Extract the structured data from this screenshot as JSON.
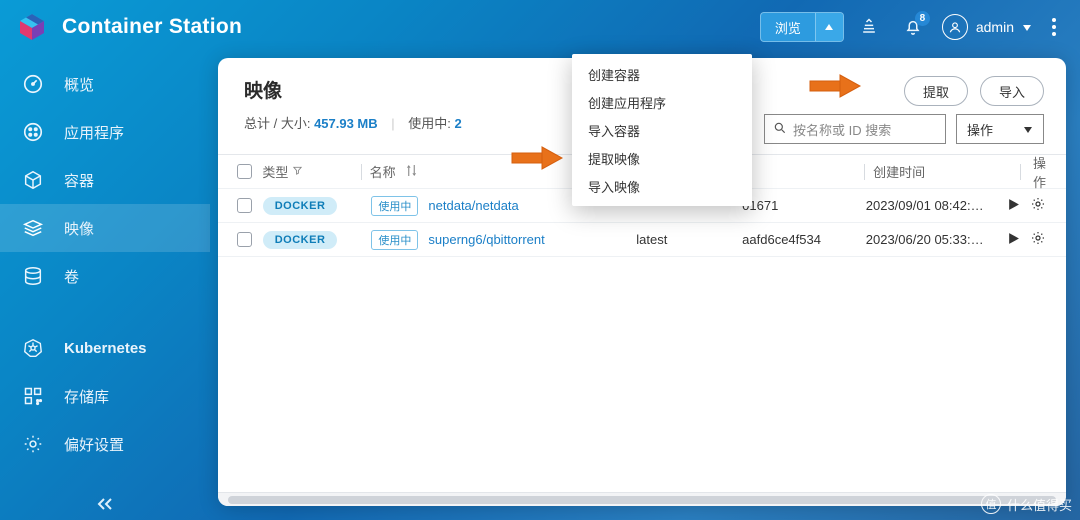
{
  "appTitle": "Container Station",
  "topbar": {
    "browseLabel": "浏览",
    "notifCount": "8",
    "userName": "admin"
  },
  "sidebar": {
    "items": [
      {
        "label": "概览"
      },
      {
        "label": "应用程序"
      },
      {
        "label": "容器"
      },
      {
        "label": "映像"
      },
      {
        "label": "卷"
      }
    ],
    "items2": [
      {
        "label": "Kubernetes"
      },
      {
        "label": "存储库"
      },
      {
        "label": "偏好设置"
      }
    ]
  },
  "panel": {
    "title": "映像",
    "totalsPrefix": "总计 / 大小: ",
    "totalsSize": "457.93 MB",
    "inusePrefix": "使用中: ",
    "inuseCount": "2",
    "pullBtn": "提取",
    "importBtn": "导入",
    "searchPlaceholder": "按名称或 ID 搜索",
    "opsLabel": "操作"
  },
  "dropdown": {
    "items": [
      "创建容器",
      "创建应用程序",
      "导入容器",
      "提取映像",
      "导入映像"
    ]
  },
  "table": {
    "headers": {
      "type": "类型",
      "name": "名称",
      "createdAt": "创建时间",
      "actions": "操作"
    },
    "rows": [
      {
        "engine": "DOCKER",
        "status": "使用中",
        "name": "netdata/netdata",
        "tag": "",
        "imageId": "01671",
        "created": "2023/09/01 08:42:…"
      },
      {
        "engine": "DOCKER",
        "status": "使用中",
        "name": "superng6/qbittorrent",
        "tag": "latest",
        "imageId": "aafd6ce4f534",
        "created": "2023/06/20 05:33:…"
      }
    ]
  },
  "watermark": "什么值得买"
}
